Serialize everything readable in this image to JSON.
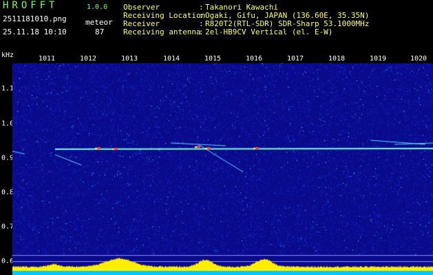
{
  "app": {
    "name": "HROFFT",
    "version": "1.0.0"
  },
  "file": {
    "name": "2511181010.png",
    "timestamp": "25.11.18 10:10"
  },
  "mode": {
    "label": "meteor",
    "count": "87"
  },
  "info": [
    {
      "label": "Observer",
      "value": "Takanori Kawachi"
    },
    {
      "label": "Receiving Location",
      "value": "Ogaki, Gifu, JAPAN (136.60E, 35.35N)"
    },
    {
      "label": "Receiver",
      "value": "R820T2(RTL-SDR) SDR-Sharp 53.1000MHz"
    },
    {
      "label": "Receiving antenna",
      "value": "2el-HB9CV Vertical (el. E-W)"
    }
  ],
  "axis": {
    "unit": "kHz",
    "x_ticks": [
      "1011",
      "1012",
      "1013",
      "1014",
      "1015",
      "1016",
      "1017",
      "1018",
      "1019",
      "1020"
    ],
    "y_ticks": [
      "1.1",
      "1.0",
      "0.9",
      "0.8",
      "0.7",
      "0.6"
    ]
  },
  "colors": {
    "background": "#0a0a8c",
    "noise_low": "#1a3cff",
    "noise_high": "#3fe0ff",
    "signal_line": "#7fffd4",
    "hot": "#ff4040",
    "level_fill": "#ffee00",
    "level_base": "#00c8ff",
    "header_info": "#ffff66",
    "app_name": "#7dff5a"
  }
}
